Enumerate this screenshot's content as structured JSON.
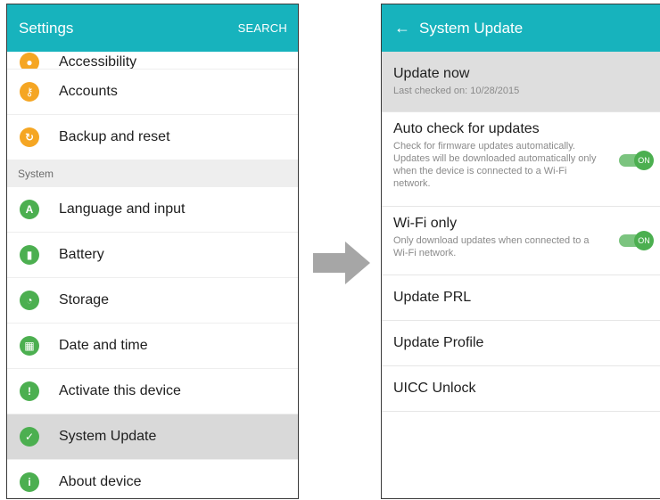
{
  "left": {
    "title": "Settings",
    "search_label": "SEARCH",
    "items_top": [
      {
        "label": "Accessibility",
        "icon": "accessibility-icon",
        "color": "#f5a623",
        "glyph": "●"
      },
      {
        "label": "Accounts",
        "icon": "key-icon",
        "color": "#f5a623",
        "glyph": "⚷"
      },
      {
        "label": "Backup and reset",
        "icon": "backup-icon",
        "color": "#f5a623",
        "glyph": "↻"
      }
    ],
    "section_label": "System",
    "items_system": [
      {
        "label": "Language and input",
        "icon": "language-icon",
        "color": "#4caf50",
        "glyph": "A"
      },
      {
        "label": "Battery",
        "icon": "battery-icon",
        "color": "#4caf50",
        "glyph": "▮"
      },
      {
        "label": "Storage",
        "icon": "storage-icon",
        "color": "#4caf50",
        "glyph": "◔"
      },
      {
        "label": "Date and time",
        "icon": "calendar-icon",
        "color": "#4caf50",
        "glyph": "▦"
      },
      {
        "label": "Activate this device",
        "icon": "activate-icon",
        "color": "#4caf50",
        "glyph": "!"
      },
      {
        "label": "System Update",
        "icon": "system-update-icon",
        "color": "#4caf50",
        "glyph": "✓",
        "selected": true
      },
      {
        "label": "About device",
        "icon": "info-icon",
        "color": "#4caf50",
        "glyph": "i"
      }
    ]
  },
  "right": {
    "back_glyph": "←",
    "title": "System Update",
    "update_now": {
      "title": "Update now",
      "subtitle": "Last checked on: 10/28/2015"
    },
    "auto_check": {
      "title": "Auto check for updates",
      "subtitle": "Check for firmware updates automatically. Updates will be downloaded automatically only when the device is connected to a Wi-Fi network.",
      "toggle_label": "ON"
    },
    "wifi_only": {
      "title": "Wi-Fi only",
      "subtitle": "Only download updates when connected to a Wi-Fi network.",
      "toggle_label": "ON"
    },
    "plain_items": [
      "Update PRL",
      "Update Profile",
      "UICC Unlock"
    ]
  },
  "colors": {
    "accent": "#17b3bd",
    "orange_icon": "#f5a623",
    "green_icon": "#4caf50",
    "arrow": "#a6a6a6"
  }
}
